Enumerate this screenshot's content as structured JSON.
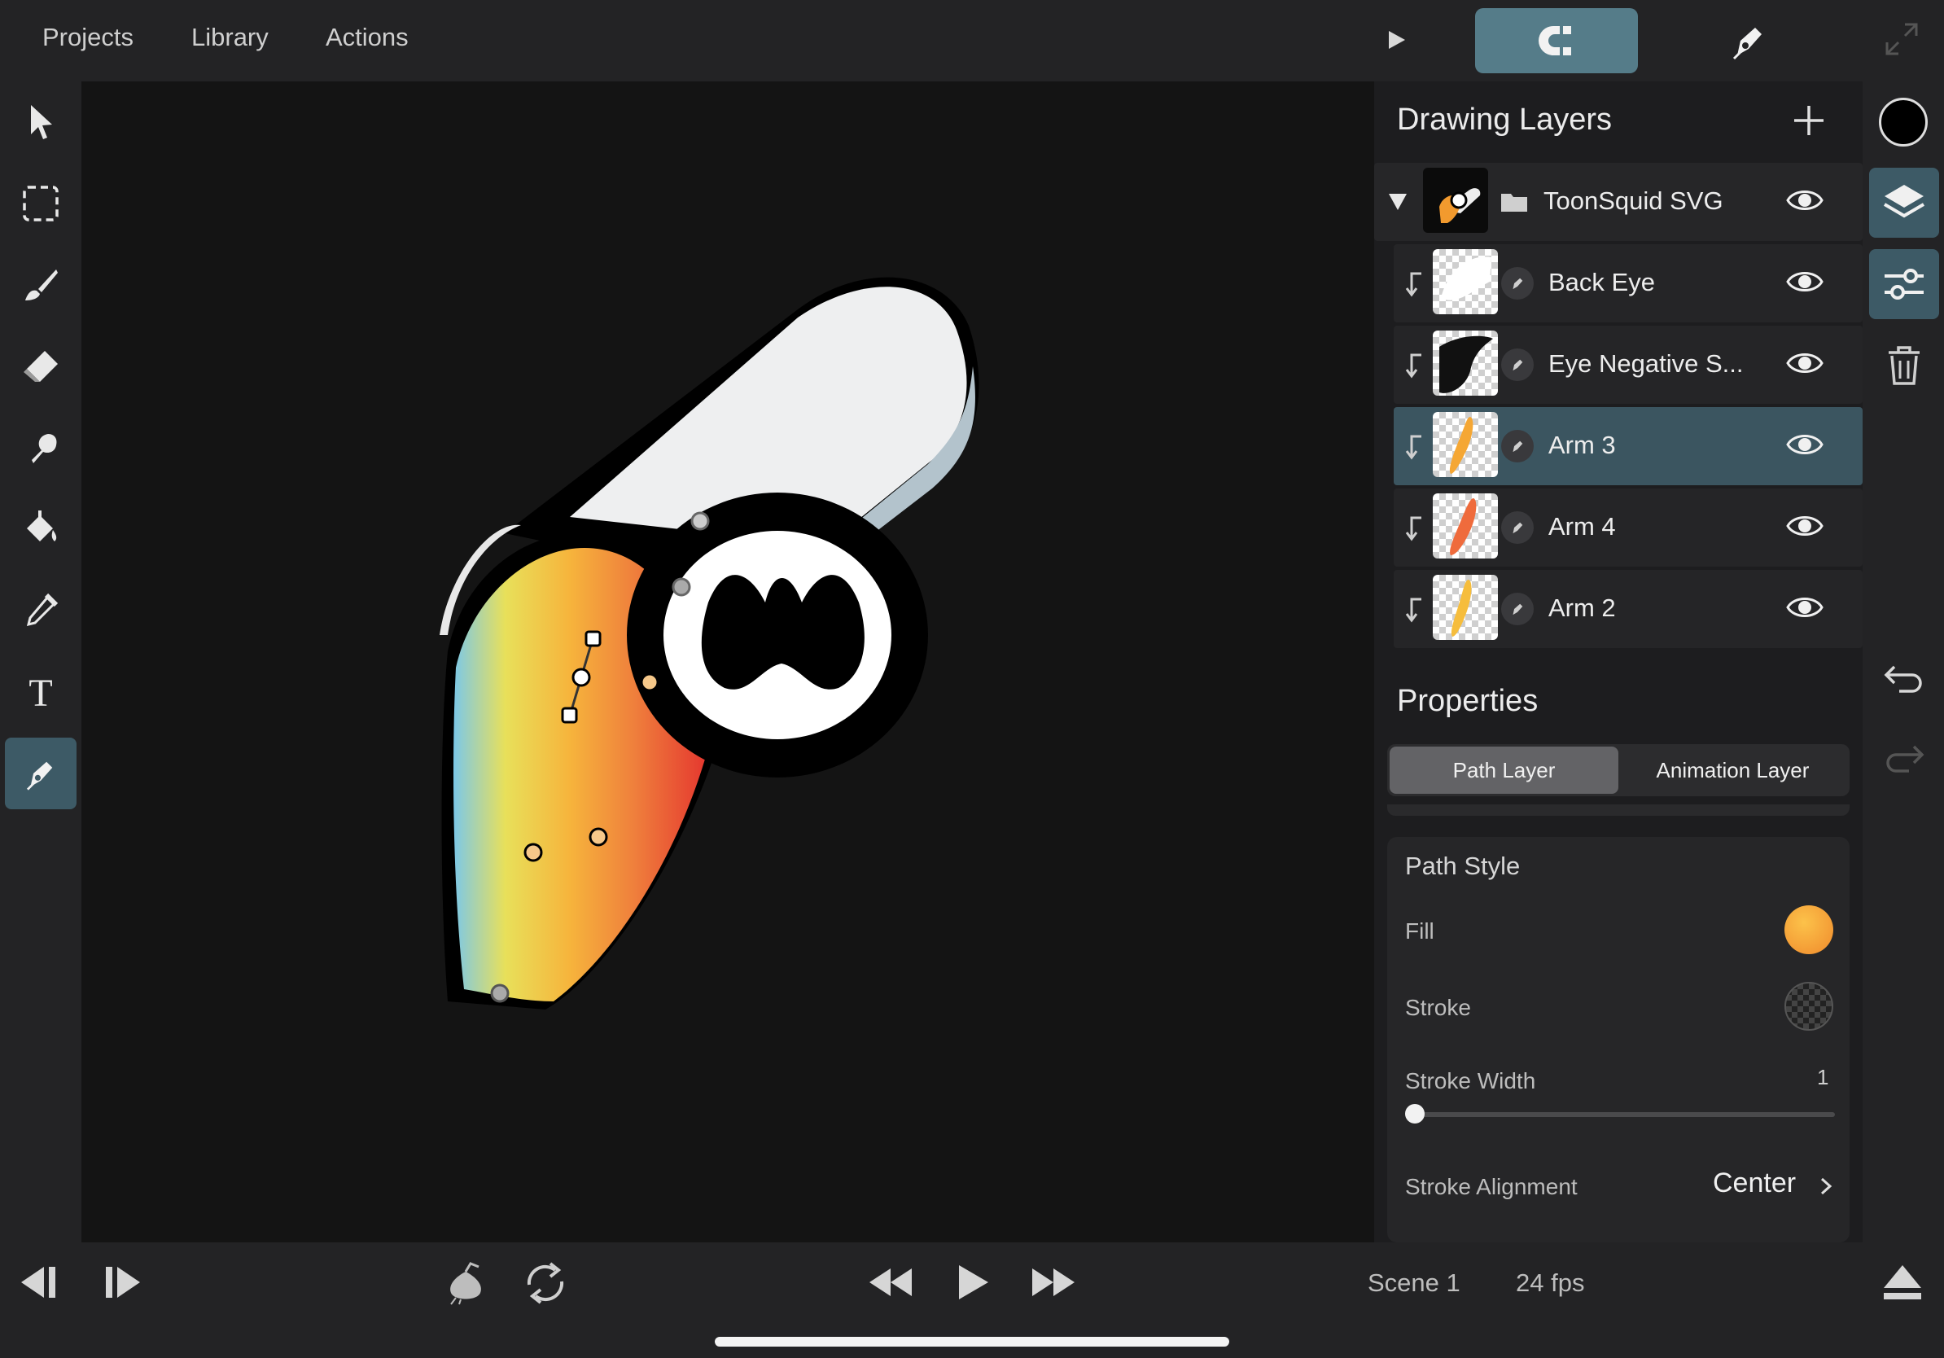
{
  "menu": {
    "projects": "Projects",
    "library": "Library",
    "actions": "Actions"
  },
  "tools": [
    "select-arrow-icon",
    "marquee-select-icon",
    "brush-icon",
    "eraser-icon",
    "smudge-icon",
    "paint-bucket-icon",
    "eyedropper-icon",
    "text-icon",
    "pen-tool-icon"
  ],
  "active_tool": "pen-tool-icon",
  "layers_panel": {
    "title": "Drawing Layers",
    "group": {
      "name": "ToonSquid SVG",
      "expanded": true
    },
    "layers": [
      {
        "name": "Back Eye",
        "selected": false
      },
      {
        "name": "Eye Negative S...",
        "selected": false
      },
      {
        "name": "Arm 3",
        "selected": true
      },
      {
        "name": "Arm 4",
        "selected": false
      },
      {
        "name": "Arm 2",
        "selected": false
      }
    ]
  },
  "properties": {
    "title": "Properties",
    "tabs": {
      "path": "Path Layer",
      "animation": "Animation Layer"
    },
    "active_tab": "Path Layer",
    "path_style": {
      "title": "Path Style",
      "fill_label": "Fill",
      "fill_color": "#f29a2e",
      "stroke_label": "Stroke",
      "stroke_width_label": "Stroke Width",
      "stroke_width_value": "1",
      "stroke_alignment_label": "Stroke Alignment",
      "stroke_alignment_value": "Center"
    }
  },
  "current_color": "#000000",
  "playback": {
    "scene": "Scene 1",
    "fps": "24 fps"
  },
  "colors": {
    "accent": "#557c89",
    "selected_row": "#3b5560",
    "canvas": "#141414"
  }
}
